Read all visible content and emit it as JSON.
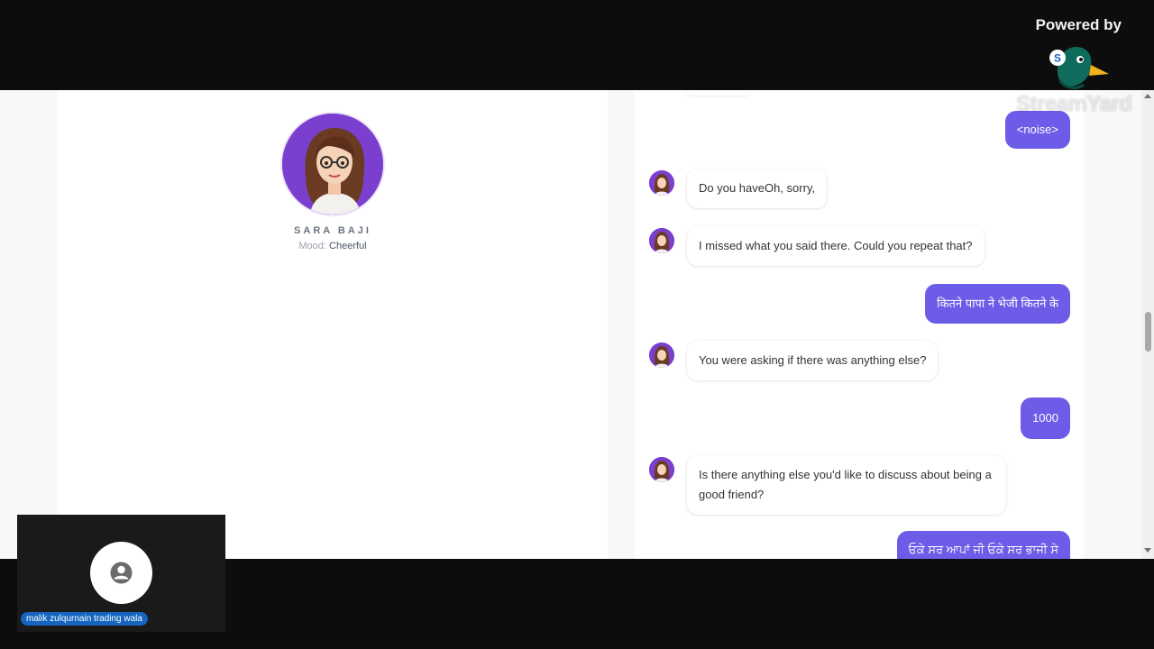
{
  "branding": {
    "powered_by": "Powered by",
    "brand_name": "StreamYard",
    "logo_letter": "S"
  },
  "profile": {
    "name": "SARA BAJI",
    "mood_label": "Mood:",
    "mood_value": "Cheerful"
  },
  "chat": {
    "messages": [
      {
        "role": "user",
        "text": "<noise>"
      },
      {
        "role": "bot",
        "text": "Do you haveOh, sorry,"
      },
      {
        "role": "bot",
        "text": "I missed what you said there. Could you repeat that?"
      },
      {
        "role": "user",
        "text": "कितने पापा ने भेजी कितने के"
      },
      {
        "role": "bot",
        "text": "You were asking if there was anything else?"
      },
      {
        "role": "user",
        "text": "1000"
      },
      {
        "role": "bot",
        "text": "Is there anything else you'd like to discuss about being a good friend?"
      },
      {
        "role": "user",
        "text": "ਓਕੇ ਸਰ ਆਪਾਂ ਜੀ ਓਕੇ ਸਰ ਭਾਜੀ ਸੇ"
      }
    ]
  },
  "participant": {
    "name": "malik zulqurnain trading wala"
  },
  "colors": {
    "accent": "#6c5ce7",
    "avatar_bg": "#7b3fd0",
    "tile_label": "#1565c0"
  }
}
